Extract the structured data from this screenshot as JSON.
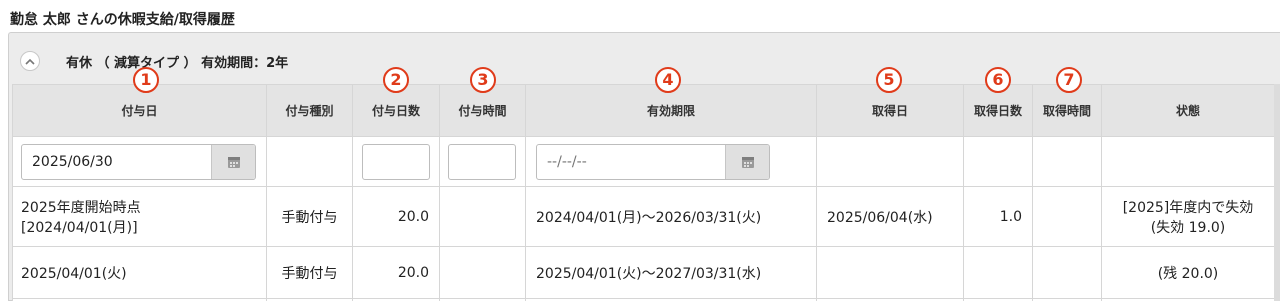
{
  "page": {
    "title": "勤怠 太郎 さんの休暇支給/取得履歴"
  },
  "section": {
    "title": "有休 （ 減算タイプ ） 有効期間：2年"
  },
  "columns": [
    {
      "label": "付与日"
    },
    {
      "label": "付与種別"
    },
    {
      "label": "付与日数"
    },
    {
      "label": "付与時間"
    },
    {
      "label": "有効期限"
    },
    {
      "label": "取得日"
    },
    {
      "label": "取得日数"
    },
    {
      "label": "取得時間"
    },
    {
      "label": "状態"
    }
  ],
  "markers": [
    "1",
    "2",
    "3",
    "4",
    "5",
    "6",
    "7"
  ],
  "filters": {
    "grant_date_value": "2025/06/30",
    "expiry_placeholder": "--/--/--"
  },
  "rows": [
    {
      "grant_date_line1": "2025年度開始時点",
      "grant_date_line2": "[2024/04/01(月)]",
      "grant_type": "手動付与",
      "grant_days": "20.0",
      "grant_hours": "",
      "expiry": "2024/04/01(月)～2026/03/31(火)",
      "taken_date": "2025/06/04(水)",
      "taken_days": "1.0",
      "taken_hours": "",
      "status_line1": "[2025]年度内で失効",
      "status_line2": "(失効 19.0)"
    },
    {
      "grant_date_line1": "2025/04/01(火)",
      "grant_date_line2": "",
      "grant_type": "手動付与",
      "grant_days": "20.0",
      "grant_hours": "",
      "expiry": "2025/04/01(火)～2027/03/31(水)",
      "taken_date": "",
      "taken_days": "",
      "taken_hours": "",
      "status_line1": "(残 20.0)",
      "status_line2": ""
    }
  ],
  "icons": {
    "collapse": "chevron-up-icon",
    "calendar": "calendar-icon"
  },
  "colors": {
    "marker": "#e03b1a",
    "header_bg": "#e4e4e4",
    "panel_bg": "#ececec"
  }
}
